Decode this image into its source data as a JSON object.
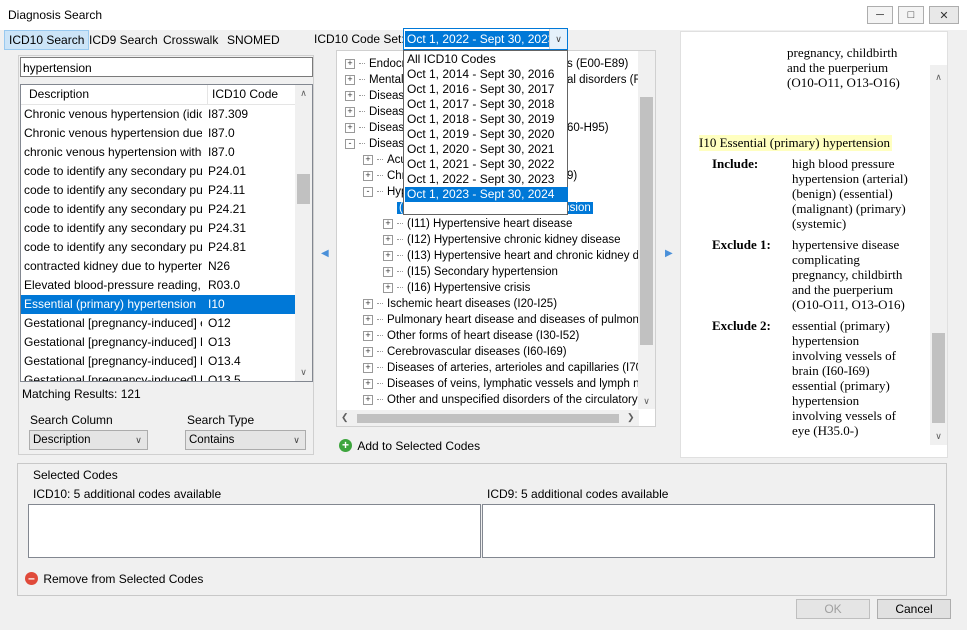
{
  "window": {
    "title": "Diagnosis Search"
  },
  "tabs": [
    "ICD10 Search",
    "ICD9 Search",
    "Crosswalk",
    "SNOMED"
  ],
  "code_set": {
    "label": "ICD10 Code Set:",
    "selected": "Oct 1, 2022 - Sept 30, 2023",
    "options": [
      "All ICD10 Codes",
      "Oct 1, 2014 - Sept 30, 2016",
      "Oct 1, 2016 - Sept 30, 2017",
      "Oct 1, 2017 - Sept 30, 2018",
      "Oct 1, 2018 - Sept 30, 2019",
      "Oct 1, 2019 - Sept 30, 2020",
      "Oct 1, 2020 - Sept 30, 2021",
      "Oct 1, 2021 - Sept 30, 2022",
      "Oct 1, 2022 - Sept 30, 2023",
      "Oct 1, 2023 - Sept 30, 2024"
    ],
    "highlighted": "Oct 1, 2023 - Sept 30, 2024"
  },
  "search": {
    "value": "hypertension"
  },
  "results": {
    "columns": [
      "Description",
      "ICD10 Code"
    ],
    "rows": [
      {
        "desc": "Chronic venous hypertension (idiop...",
        "code": "I87.309"
      },
      {
        "desc": "Chronic venous hypertension due t...",
        "code": "I87.0"
      },
      {
        "desc": "chronic venous hypertension witho...",
        "code": "I87.0"
      },
      {
        "desc": "code to identify any secondary pul...",
        "code": "P24.01"
      },
      {
        "desc": "code to identify any secondary pul...",
        "code": "P24.11"
      },
      {
        "desc": "code to identify any secondary pul...",
        "code": "P24.21"
      },
      {
        "desc": "code to identify any secondary pul...",
        "code": "P24.31"
      },
      {
        "desc": "code to identify any secondary pul...",
        "code": "P24.81"
      },
      {
        "desc": "contracted kidney due to hypertens...",
        "code": "N26"
      },
      {
        "desc": "Elevated blood-pressure reading, wi...",
        "code": "R03.0"
      },
      {
        "desc": "Essential (primary) hypertension",
        "code": "I10"
      },
      {
        "desc": "Gestational [pregnancy-induced] ed...",
        "code": "O12"
      },
      {
        "desc": "Gestational [pregnancy-induced] hy...",
        "code": "O13"
      },
      {
        "desc": "Gestational [pregnancy-induced] hy...",
        "code": "O13.4"
      },
      {
        "desc": "Gestational [pregnancy-induced] hy...",
        "code": "O13.5"
      }
    ],
    "selected_index": 10,
    "matching": "Matching Results: 121"
  },
  "search_column": {
    "label": "Search Column",
    "value": "Description"
  },
  "search_type": {
    "label": "Search Type",
    "value": "Contains"
  },
  "tree": {
    "nodes": [
      {
        "text": "Endocrine, nutritional and metabolic diseases (E00-E89)",
        "visible": "Endocrin",
        "tail": "s (E00-E89)",
        "level": 0,
        "pm": "+"
      },
      {
        "text": "Mental, Behavioral and Neurodevelopmental disorders (F01-F99)",
        "visible": "Mental, B",
        "tail": "al disorders (F0",
        "level": 0,
        "pm": "+"
      },
      {
        "text": "Diseases",
        "visible": "Diseases",
        "tail": "",
        "level": 0,
        "pm": "+"
      },
      {
        "text": "Diseases",
        "visible": "Diseases",
        "tail": "",
        "level": 0,
        "pm": "+"
      },
      {
        "text": "Diseases",
        "visible": "Diseases",
        "tail": "60-H95)",
        "level": 0,
        "pm": "+"
      },
      {
        "text": "Diseases",
        "visible": "Diseases",
        "tail": "",
        "level": 0,
        "pm": "-"
      },
      {
        "text": "Acut",
        "visible": "Acut",
        "tail": "",
        "level": 1,
        "pm": "+"
      },
      {
        "text": "Chro",
        "visible": "Chro",
        "tail": "9)",
        "level": 1,
        "pm": "+"
      },
      {
        "text": "Hype",
        "visible": "Hype",
        "tail": "",
        "level": 1,
        "pm": "-"
      },
      {
        "text": "(I10) Essential (primary) hypertension",
        "visible": "(I10) Essential (primary) hypertension",
        "tail": "",
        "level": 2,
        "pm": "",
        "selected": true
      },
      {
        "text": "(I11) Hypertensive heart disease",
        "visible": "(I11) Hypertensive heart disease",
        "tail": "",
        "level": 2,
        "pm": "+"
      },
      {
        "text": "(I12) Hypertensive chronic kidney disease",
        "visible": "(I12) Hypertensive chronic kidney disease",
        "tail": "",
        "level": 2,
        "pm": "+"
      },
      {
        "text": "(I13) Hypertensive heart and chronic kidney disease",
        "visible": "(I13) Hypertensive heart and chronic kidney diseas",
        "tail": "",
        "level": 2,
        "pm": "+"
      },
      {
        "text": "(I15) Secondary hypertension",
        "visible": "(I15) Secondary hypertension",
        "tail": "",
        "level": 2,
        "pm": "+"
      },
      {
        "text": "(I16) Hypertensive crisis",
        "visible": "(I16) Hypertensive crisis",
        "tail": "",
        "level": 2,
        "pm": "+"
      },
      {
        "text": "Ischemic heart diseases (I20-I25)",
        "visible": "Ischemic heart diseases (I20-I25)",
        "tail": "",
        "level": 1,
        "pm": "+"
      },
      {
        "text": "Pulmonary heart disease and diseases of pulmonary circulation",
        "visible": "Pulmonary heart disease and diseases of pulmonary cir",
        "tail": "",
        "level": 1,
        "pm": "+"
      },
      {
        "text": "Other forms of heart disease (I30-I52)",
        "visible": "Other forms of heart disease (I30-I52)",
        "tail": "",
        "level": 1,
        "pm": "+"
      },
      {
        "text": "Cerebrovascular diseases (I60-I69)",
        "visible": "Cerebrovascular diseases (I60-I69)",
        "tail": "",
        "level": 1,
        "pm": "+"
      },
      {
        "text": "Diseases of arteries, arterioles and capillaries (I70-I79)",
        "visible": "Diseases of arteries, arterioles and capillaries (I70-I79)",
        "tail": "",
        "level": 1,
        "pm": "+"
      },
      {
        "text": "Diseases of veins, lymphatic vessels and lymph nodes",
        "visible": "Diseases of veins, lymphatic vessels and lymph nodes,",
        "tail": "",
        "level": 1,
        "pm": "+"
      },
      {
        "text": "Other and unspecified disorders of the circulatory system",
        "visible": "Other and unspecified disorders of the circulatory syste",
        "tail": "",
        "level": 1,
        "pm": "+"
      }
    ],
    "add_button": "Add to Selected Codes"
  },
  "detail": {
    "top_lines": [
      "pregnancy, childbirth",
      "and the puerperium",
      "(O10-O11, O13-O16)"
    ],
    "heading": "I10 Essential (primary) hypertension",
    "include_label": "Include:",
    "include_lines": [
      "high blood pressure",
      "hypertension (arterial)",
      "(benign) (essential)",
      "(malignant) (primary)",
      "(systemic)"
    ],
    "exclude1_label": "Exclude 1:",
    "exclude1_lines": [
      "hypertensive disease",
      "complicating",
      "pregnancy, childbirth",
      "and the puerperium",
      "(O10-O11, O13-O16)"
    ],
    "exclude2_label": "Exclude 2:",
    "exclude2_lines": [
      "essential (primary)",
      "hypertension",
      "involving vessels of",
      "brain (I60-I69)",
      "essential (primary)",
      "hypertension",
      "involving vessels of",
      "eye (H35.0-)"
    ],
    "heading_bg": "#ffffc0"
  },
  "selected_codes": {
    "title": "Selected Codes",
    "icd10_label": "ICD10:  5 additional codes available",
    "icd9_label": "ICD9:  5 additional codes available",
    "remove_button": "Remove from Selected Codes"
  },
  "footer": {
    "ok": "OK",
    "cancel": "Cancel"
  },
  "colors": {
    "selection": "#0078d7",
    "tab_active": "#cce4f7"
  }
}
